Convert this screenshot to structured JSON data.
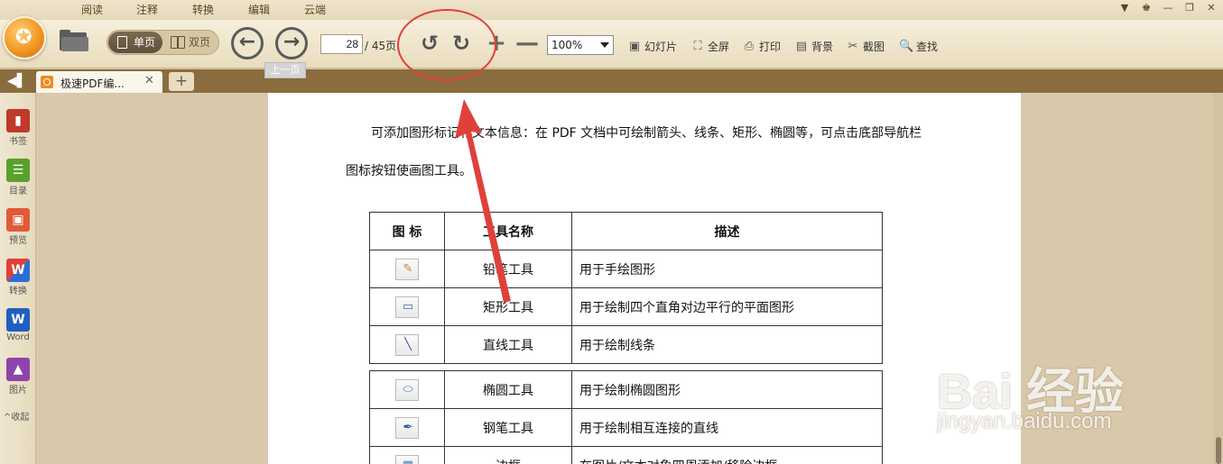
{
  "menu": {
    "tabs": [
      "阅读",
      "注释",
      "转换",
      "编辑",
      "云端"
    ]
  },
  "window_controls": [
    "▼",
    "♚",
    "—",
    "❐",
    "✕"
  ],
  "toolbar": {
    "view_single": "单页",
    "view_double": "双页",
    "prev_icon": "←",
    "next_icon": "→",
    "page_current": "28",
    "page_total": "/ 45页",
    "rotate_left_icon": "↺",
    "rotate_right_icon": "↻",
    "zoom_in_icon": "+",
    "zoom_out_icon": "—",
    "zoom_value": "100%",
    "tools": [
      {
        "label": "幻灯片",
        "icon": "▣"
      },
      {
        "label": "全屏",
        "icon": "⛶"
      },
      {
        "label": "打印",
        "icon": "⎙"
      },
      {
        "label": "背景",
        "icon": "▤"
      },
      {
        "label": "截图",
        "icon": "✂"
      },
      {
        "label": "查找",
        "icon": "🔍"
      }
    ],
    "tooltip": "上一页"
  },
  "tabs": {
    "doc_title": "极速PDF编...",
    "close_icon": "✕",
    "add_icon": "+",
    "sidebar_toggle_icon": "◀▌"
  },
  "sidebar": {
    "items": [
      {
        "label": "书签",
        "glyph": "▮",
        "color": "#c0392b"
      },
      {
        "label": "目录",
        "glyph": "☰",
        "color": "#5aa02c"
      },
      {
        "label": "预览",
        "glyph": "▣",
        "color": "#e05a3a"
      },
      {
        "label": "转换",
        "glyph": "W",
        "color": "#2b6fd6"
      },
      {
        "label": "Word",
        "glyph": "W",
        "color": "#1f5fbf"
      },
      {
        "label": "图片",
        "glyph": "▲",
        "color": "#8e44ad"
      }
    ],
    "collapse": "^收起"
  },
  "document": {
    "para1": "可添加图形标记和文本信息：在 PDF 文档中可绘制箭头、线条、矩形、椭圆等，可点击底部导航栏",
    "para2": "图标按钮使画图工具。",
    "table_headers": [
      "图 标",
      "工具名称",
      "描述"
    ],
    "table1_rows": [
      {
        "icon": "✎",
        "name": "铅笔工具",
        "desc": "用于手绘图形"
      },
      {
        "icon": "▭",
        "name": "矩形工具",
        "desc": "用于绘制四个直角对边平行的平面图形"
      },
      {
        "icon": "╲",
        "name": "直线工具",
        "desc": "用于绘制线条"
      }
    ],
    "table2_rows": [
      {
        "icon": "⬭",
        "name": "椭圆工具",
        "desc": "用于绘制椭圆图形"
      },
      {
        "icon": "✒",
        "name": "钢笔工具",
        "desc": "用于绘制相互连接的直线"
      },
      {
        "icon": "▦",
        "name": "边框",
        "desc": "在图片/文本对象四周添加/移除边框"
      }
    ]
  },
  "colors": {
    "annotation": "#e0403a",
    "toolbar_bg": "#efe4cc",
    "tabbar_bg": "#8a6c3e",
    "canvas_bg": "#d8c9aa"
  },
  "watermark": {
    "text": "Bai 经验",
    "url": "jingyan.baidu.com"
  }
}
